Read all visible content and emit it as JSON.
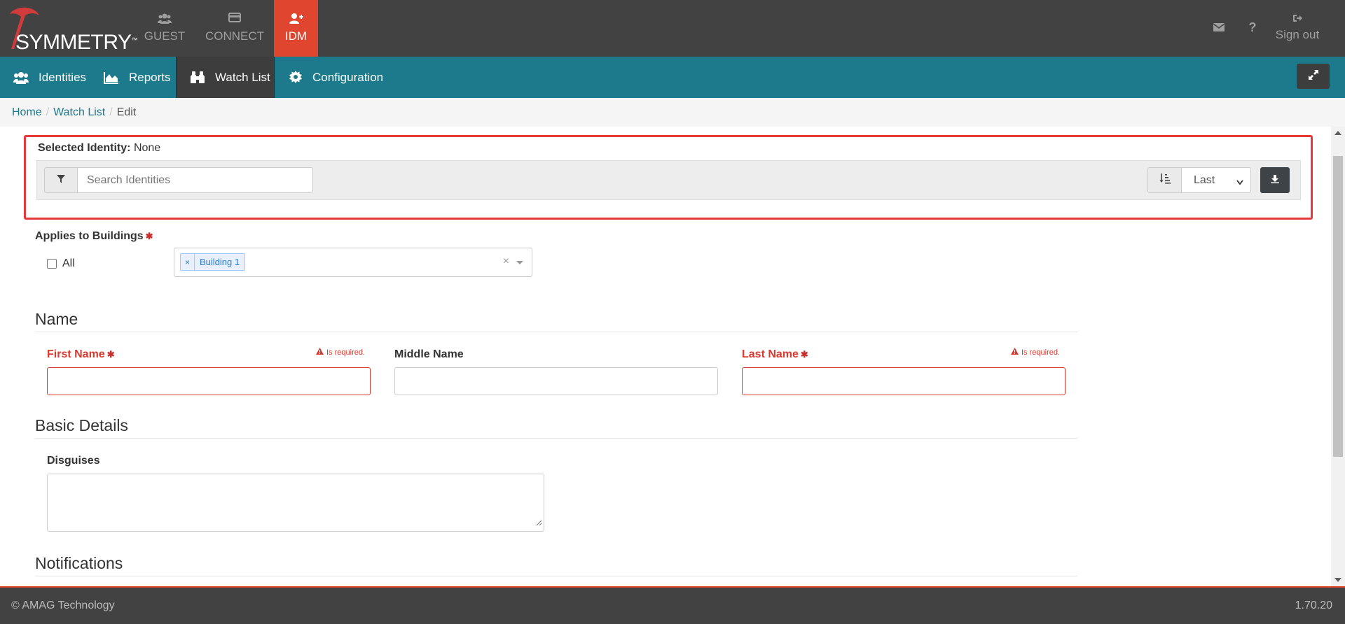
{
  "topbar": {
    "logo_text": "SYMMETRY",
    "logo_tm": "™",
    "apps": [
      {
        "label": "GUEST",
        "icon": "users-icon"
      },
      {
        "label": "CONNECT",
        "icon": "card-icon"
      },
      {
        "label": "IDM",
        "icon": "user-plus-icon"
      }
    ],
    "active_app": "IDM",
    "signout_label": "Sign out"
  },
  "navbar": {
    "items": [
      {
        "label": "Identities",
        "icon": "users-icon"
      },
      {
        "label": "Reports",
        "icon": "area-chart-icon"
      },
      {
        "label": "Watch List",
        "icon": "binoculars-icon"
      },
      {
        "label": "Configuration",
        "icon": "gear-icon"
      }
    ],
    "active_item": "Watch List"
  },
  "breadcrumb": {
    "items": [
      "Home",
      "Watch List"
    ],
    "current": "Edit"
  },
  "selected_identity": {
    "label": "Selected Identity:",
    "value": "None"
  },
  "search": {
    "placeholder": "Search Identities",
    "sort_selected": "Last"
  },
  "buildings": {
    "label": "Applies to Buildings",
    "all_label": "All",
    "selected_tags": [
      "Building 1"
    ],
    "clear_symbol": "×",
    "tag_remove_symbol": "×"
  },
  "name_section": {
    "title": "Name",
    "first_name_label": "First Name",
    "middle_name_label": "Middle Name",
    "last_name_label": "Last Name",
    "required_msg": "Is required."
  },
  "basic_details": {
    "title": "Basic Details",
    "disguises_label": "Disguises"
  },
  "notifications": {
    "title": "Notifications"
  },
  "footer": {
    "copyright": "© AMAG Technology",
    "version": "1.70.20"
  },
  "colors": {
    "topbar_bg": "#424242",
    "nav_bg": "#1d7a8c",
    "active_app_bg": "#e0452f",
    "highlight_border": "#e5383b",
    "error": "#d9392f"
  }
}
